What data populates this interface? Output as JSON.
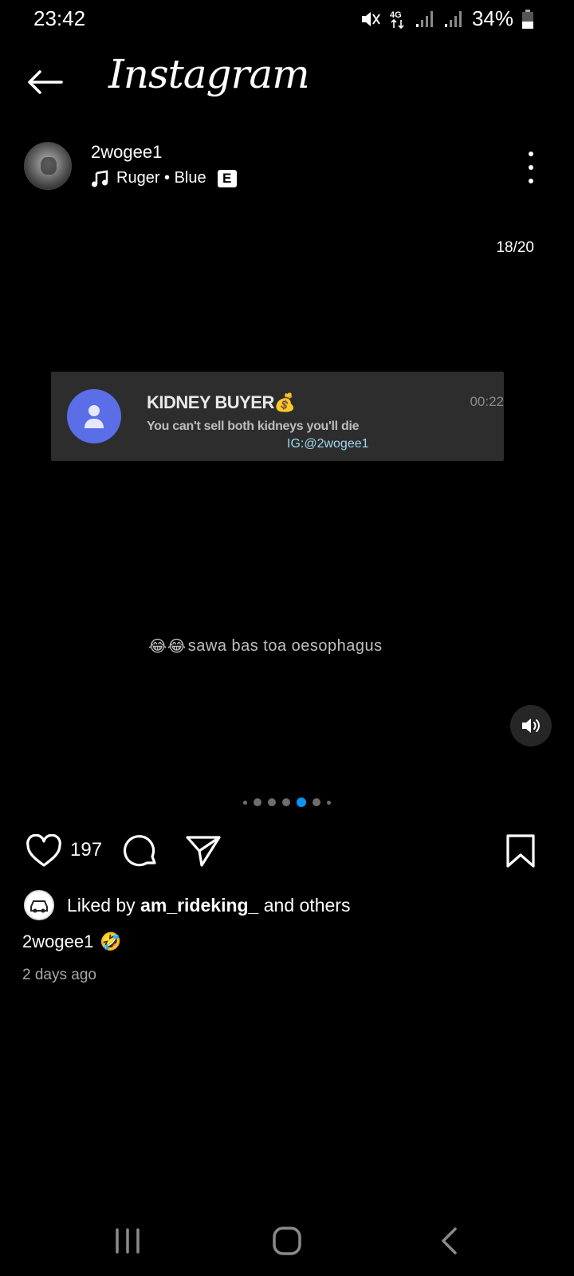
{
  "status_bar": {
    "time": "23:42",
    "network": "4G",
    "battery": "34%"
  },
  "app": {
    "title": "Instagram"
  },
  "post": {
    "username": "2wogee1",
    "music": "Ruger • Blue",
    "explicit_badge": "E",
    "counter": "18/20",
    "media": {
      "notification_title": "KIDNEY BUYER💰",
      "notification_text": "You can't sell both kidneys you'll die",
      "notification_time": "00:22",
      "watermark": "IG:@2wogee1",
      "overlay_caption": "sawa bas toa oesophagus",
      "overlay_emojis": "😂😂"
    },
    "carousel": {
      "active_index": 4,
      "dot_count": 7
    },
    "like_count": "197",
    "liked_by_prefix": "Liked by ",
    "liked_by_user": "am_rideking_",
    "liked_by_suffix": " and others",
    "caption_user": "2wogee1",
    "caption_emoji": "🤣",
    "time_ago": "2 days ago"
  },
  "icons": {
    "back": "arrow-left-icon",
    "more": "more-vertical-icon",
    "music": "music-note-icon",
    "sound": "volume-on-icon",
    "like": "heart-icon",
    "comment": "comment-icon",
    "share": "paper-plane-icon",
    "save": "bookmark-icon"
  },
  "colors": {
    "background": "#000000",
    "accent": "#0a95f5",
    "notif_avatar": "#5b6ee8"
  }
}
